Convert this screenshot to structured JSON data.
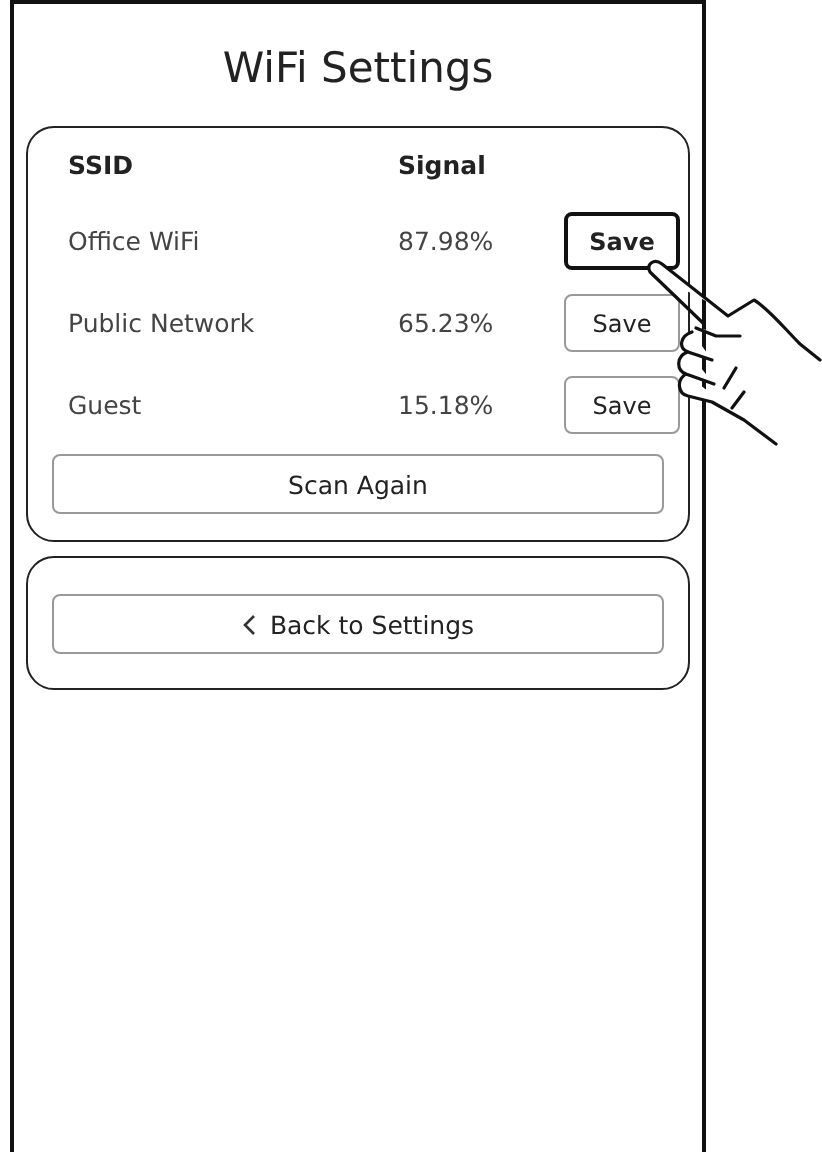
{
  "title": "WiFi Settings",
  "table": {
    "columns": [
      "SSID",
      "Signal"
    ],
    "rows": [
      {
        "ssid": "Office WiFi",
        "signal": "87.98%",
        "button": {
          "label": "Save",
          "selected": true
        }
      },
      {
        "ssid": "Public Network",
        "signal": "65.23%",
        "button": {
          "label": "Save",
          "selected": false
        }
      },
      {
        "ssid": "Guest",
        "signal": "15.18%",
        "button": {
          "label": "Save",
          "selected": false
        }
      }
    ]
  },
  "scan_button": "Scan Again",
  "back_button": "Back to Settings"
}
